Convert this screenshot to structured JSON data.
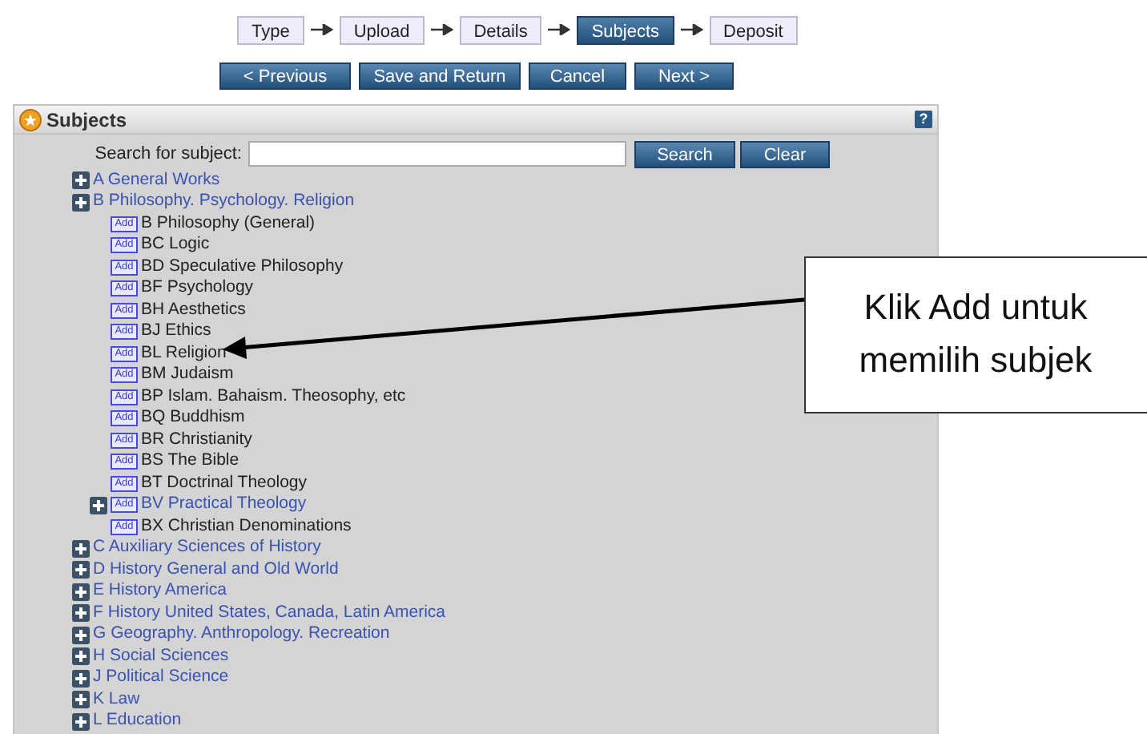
{
  "steps": [
    {
      "label": "Type",
      "selected": false
    },
    {
      "label": "Upload",
      "selected": false
    },
    {
      "label": "Details",
      "selected": false
    },
    {
      "label": "Subjects",
      "selected": true
    },
    {
      "label": "Deposit",
      "selected": false
    }
  ],
  "buttons": [
    "< Previous",
    "Save and Return",
    "Cancel",
    "Next >"
  ],
  "panel": {
    "title": "Subjects",
    "help": "?",
    "search": {
      "label": "Search for subject:",
      "buttons": [
        "Search",
        "Clear"
      ]
    },
    "tree": [
      {
        "label": "A General Works",
        "expandable": true
      },
      {
        "label": "B Philosophy. Psychology. Religion",
        "expandable": true,
        "children": [
          {
            "label": "B Philosophy (General)",
            "expandable": false,
            "add": "Add"
          },
          {
            "label": "BC Logic",
            "expandable": false,
            "add": "Add"
          },
          {
            "label": "BD Speculative Philosophy",
            "expandable": false,
            "add": "Add"
          },
          {
            "label": "BF Psychology",
            "expandable": false,
            "add": "Add"
          },
          {
            "label": "BH Aesthetics",
            "expandable": false,
            "add": "Add"
          },
          {
            "label": "BJ Ethics",
            "expandable": false,
            "add": "Add"
          },
          {
            "label": "BL Religion",
            "expandable": false,
            "add": "Add"
          },
          {
            "label": "BM Judaism",
            "expandable": false,
            "add": "Add"
          },
          {
            "label": "BP Islam. Bahaism. Theosophy, etc",
            "expandable": false,
            "add": "Add"
          },
          {
            "label": "BQ Buddhism",
            "expandable": false,
            "add": "Add"
          },
          {
            "label": "BR Christianity",
            "expandable": false,
            "add": "Add"
          },
          {
            "label": "BS The Bible",
            "expandable": false,
            "add": "Add"
          },
          {
            "label": "BT Doctrinal Theology",
            "expandable": false,
            "add": "Add"
          },
          {
            "label": "BV Practical Theology",
            "expandable": true,
            "add": "Add"
          },
          {
            "label": "BX Christian Denominations",
            "expandable": false,
            "add": "Add"
          }
        ]
      },
      {
        "label": "C Auxiliary Sciences of History",
        "expandable": true
      },
      {
        "label": "D History General and Old World",
        "expandable": true
      },
      {
        "label": "E History America",
        "expandable": true
      },
      {
        "label": "F History United States, Canada, Latin America",
        "expandable": true
      },
      {
        "label": "G Geography. Anthropology. Recreation",
        "expandable": true
      },
      {
        "label": "H Social Sciences",
        "expandable": true
      },
      {
        "label": "J Political Science",
        "expandable": true
      },
      {
        "label": "K Law",
        "expandable": true
      },
      {
        "label": "L Education",
        "expandable": true
      }
    ]
  },
  "callout": {
    "text": "Klik Add untuk memilih subjek"
  }
}
